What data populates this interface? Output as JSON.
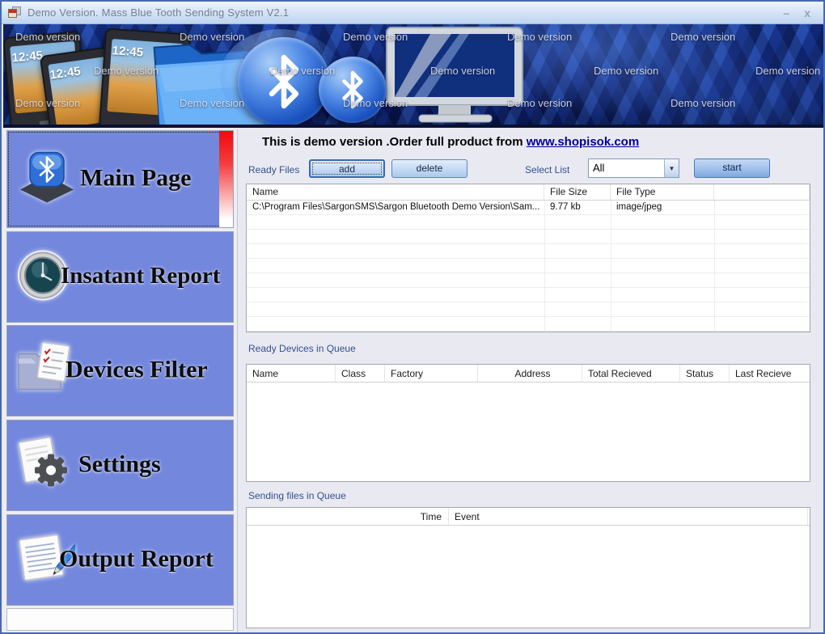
{
  "window": {
    "title": "Demo Version. Mass Blue Tooth Sending System V2.1",
    "controls": {
      "minimize": "–",
      "close": "x"
    }
  },
  "banner": {
    "watermark": "Demo version",
    "phone_time": "12:45"
  },
  "sidebar": {
    "items": [
      {
        "label": "Main Page",
        "icon": "bluetooth-icon"
      },
      {
        "label": "Insatant Report",
        "icon": "clock-icon"
      },
      {
        "label": "Devices Filter",
        "icon": "filter-documents-icon"
      },
      {
        "label": "Settings",
        "icon": "gear-paper-icon"
      },
      {
        "label": "Output Report",
        "icon": "pen-paper-icon"
      }
    ]
  },
  "main": {
    "demo_notice": {
      "text": "This is demo version .Order full product from ",
      "link": "www.shopisok.com"
    },
    "controls": {
      "ready_files_label": "Ready Files",
      "add_label": "add",
      "delete_label": "delete",
      "select_list_label": "Select List",
      "select_value": "All",
      "start_label": "start"
    },
    "files_table": {
      "columns": [
        "Name",
        "File Size",
        "File Type",
        ""
      ],
      "rows": [
        [
          "C:\\Program Files\\SargonSMS\\Sargon Bluetooth Demo Version\\Sam...",
          "9.77 kb",
          "image/jpeg",
          ""
        ]
      ]
    },
    "devices_section": {
      "label": "Ready Devices in Queue",
      "columns": [
        "Name",
        "Class",
        "Factory",
        "Address",
        "Total Recieved",
        "Status",
        "Last Recieve",
        ""
      ]
    },
    "sending_section": {
      "label": "Sending files in Queue",
      "columns": [
        "Time",
        "Event"
      ]
    }
  },
  "colors": {
    "accent_periwinkle": "#7387dd",
    "banner_navy": "#11277c",
    "link_navy": "#000099",
    "titlebar_blue": "#d7e5f7",
    "red_strip": "#f40808"
  }
}
